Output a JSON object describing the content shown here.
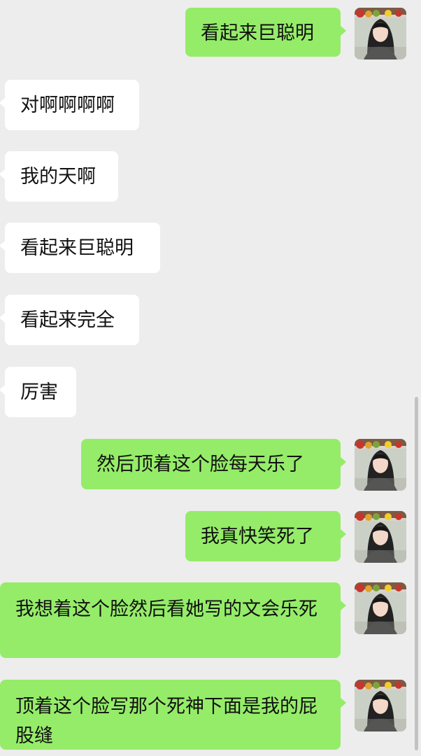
{
  "messages": [
    {
      "side": "out",
      "text": "看起来巨聪明",
      "avatar": "user-avatar-photo"
    },
    {
      "side": "in",
      "text": "对啊啊啊啊"
    },
    {
      "side": "in",
      "text": "我的天啊"
    },
    {
      "side": "in",
      "text": "看起来巨聪明"
    },
    {
      "side": "in",
      "text": "看起来完全"
    },
    {
      "side": "in",
      "text": "厉害"
    },
    {
      "side": "out",
      "text": "然后顶着这个脸每天乐了",
      "avatar": "user-avatar-photo"
    },
    {
      "side": "out",
      "text": "我真快笑死了",
      "avatar": "user-avatar-photo"
    },
    {
      "side": "out",
      "text": "我想着这个脸然后看她写的文会乐死",
      "avatar": "user-avatar-photo"
    },
    {
      "side": "out",
      "text": "顶着这个脸写那个死神下面是我的屁股缝",
      "avatar": "user-avatar-photo"
    }
  ],
  "colors": {
    "background": "#ededed",
    "incoming_bubble": "#ffffff",
    "outgoing_bubble": "#95ec69",
    "text": "#111111"
  }
}
